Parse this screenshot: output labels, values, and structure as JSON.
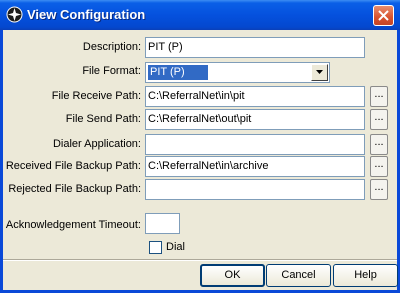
{
  "window": {
    "title": "View Configuration"
  },
  "labels": {
    "description": "Description:",
    "file_format": "File Format:",
    "file_receive_path": "File Receive Path:",
    "file_send_path": "File Send Path:",
    "dialer_application": "Dialer Application:",
    "received_file_backup_path": "Received File Backup Path:",
    "rejected_file_backup_path": "Rejected File Backup Path:",
    "acknowledgement_timeout": "Acknowledgement Timeout:",
    "dial": "Dial"
  },
  "values": {
    "description": "PIT (P)",
    "file_format": "PIT (P)",
    "file_receive_path": "C:\\ReferralNet\\in\\pit",
    "file_send_path": "C:\\ReferralNet\\out\\pit",
    "dialer_application": "",
    "received_file_backup_path": "C:\\ReferralNet\\in\\archive",
    "rejected_file_backup_path": "",
    "acknowledgement_timeout": "",
    "dial_checked": false
  },
  "browse_label": "...",
  "buttons": {
    "ok": "OK",
    "cancel": "Cancel",
    "help": "Help"
  },
  "colors": {
    "titlebar": "#0551de",
    "dialog_bg": "#ece9d8",
    "selection": "#316ac5",
    "close_button": "#d9522e"
  }
}
